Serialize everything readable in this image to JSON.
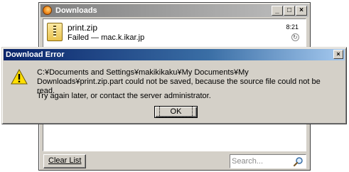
{
  "downloads_window": {
    "title": "Downloads",
    "minimize": "_",
    "maximize": "□",
    "close": "×",
    "item": {
      "filename": "print.zip",
      "status": "Failed — mac.k.ikar.jp",
      "time": "8:21",
      "retry_glyph": "↻"
    },
    "clear_list_label": "Clear List",
    "search_placeholder": "Search..."
  },
  "error_dialog": {
    "title": "Download Error",
    "close": "×",
    "message": "C:¥Documents and Settings¥makikikaku¥My Documents¥My Downloads¥print.zip.part could not be saved, because the source file could not be read.",
    "hint": "Try again later, or contact the server administrator.",
    "ok_label": "OK"
  },
  "icons": {
    "downloads_title": "firefox-icon",
    "file": "zip-file-icon",
    "warning": "warning-icon",
    "search": "search-icon"
  }
}
